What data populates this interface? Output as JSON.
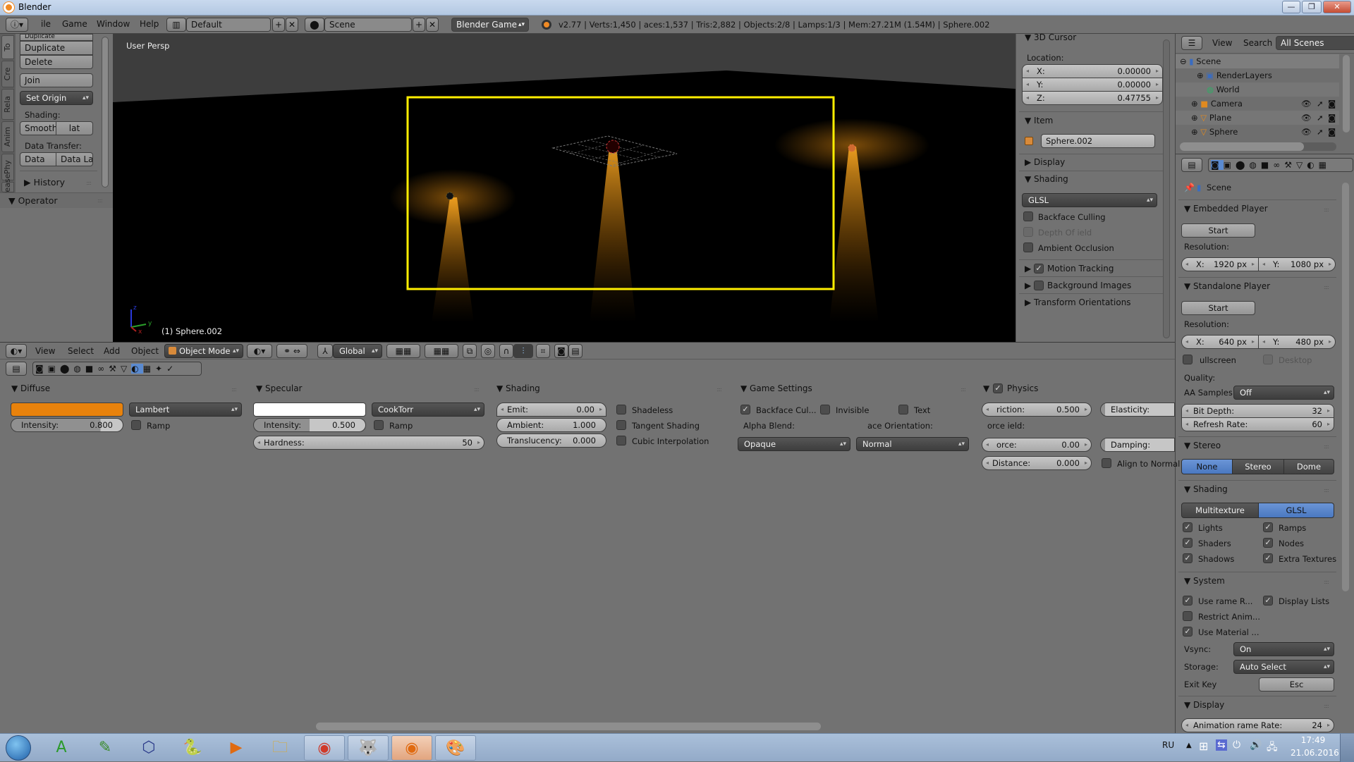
{
  "window": {
    "title": "Blender",
    "controls": {
      "minimize": "—",
      "restore": "❐",
      "close": "✕"
    }
  },
  "info_header": {
    "menus": [
      "ile",
      "Game",
      "Window",
      "Help"
    ],
    "layout": "Default",
    "scene": "Scene",
    "engine": "Blender Game",
    "stats": "v2.77 | Verts:1,450 |  aces:1,537 | Tris:2,882 | Objects:2/8 | Lamps:1/3 | Mem:27.21M (1.54M) | Sphere.002"
  },
  "tool_shelf": {
    "tabs": [
      "To",
      "Cre",
      "Rela",
      "Anim",
      "Phy",
      "Grease"
    ],
    "buttons": {
      "duplicate": "Duplicate",
      "duplicate_linked": "Duplicate Linked",
      "delete": "Delete",
      "join": "Join",
      "set_origin": "Set Origin"
    },
    "shading_label": "Shading:",
    "smooth": "Smooth",
    "flat": "lat",
    "data_transfer_label": "Data Transfer:",
    "data": "Data",
    "data_lay": "Data Lay",
    "history": "History",
    "operator": "Operator"
  },
  "viewport": {
    "view_label": "User Persp",
    "object_label": "(1) Sphere.002",
    "axis": {
      "x": "x",
      "y": "y",
      "z": "z"
    },
    "camera_frame_color": "#ffee00",
    "light_color": "#e08a10"
  },
  "n_panel": {
    "cursor_title": "3D Cursor",
    "location_label": "Location:",
    "x_label": "X:",
    "x": "0.00000",
    "y_label": "Y:",
    "y": "0.00000",
    "z_label": "Z:",
    "z": "0.47755",
    "item_title": "Item",
    "item_name": "Sphere.002",
    "display_title": "Display",
    "shading_title": "Shading",
    "shading_mode": "GLSL",
    "backface_culling": "Backface Culling",
    "depth_of_field": "Depth Of  ield",
    "ambient_occlusion": "Ambient Occlusion",
    "motion_tracking": "Motion Tracking",
    "background_images": "Background Images",
    "transform_orientations": "Transform Orientations"
  },
  "outliner": {
    "view": "View",
    "search": "Search",
    "filter": "All Scenes",
    "items": [
      {
        "name": "Scene"
      },
      {
        "name": "RenderLayers"
      },
      {
        "name": "World"
      },
      {
        "name": "Camera"
      },
      {
        "name": "Plane"
      },
      {
        "name": "Sphere"
      }
    ]
  },
  "properties": {
    "context": "Scene",
    "embedded_player": {
      "title": "Embedded Player",
      "start": "Start",
      "resolution": "Resolution:",
      "x_label": "X:",
      "x": "1920 px",
      "y_label": "Y:",
      "y": "1080 px"
    },
    "standalone_player": {
      "title": "Standalone Player",
      "start": "Start",
      "resolution": "Resolution:",
      "x_label": "X:",
      "x": "640 px",
      "y_label": "Y:",
      "y": "480 px",
      "fullscreen": "ullscreen",
      "desktop": "Desktop",
      "quality": "Quality:",
      "aa_label": "AA Samples:",
      "aa": "Off",
      "bit_depth_label": "Bit Depth:",
      "bit_depth": "32",
      "refresh_label": "Refresh Rate:",
      "refresh": "60"
    },
    "stereo": {
      "title": "Stereo",
      "options": [
        "None",
        "Stereo",
        "Dome"
      ],
      "selected": "None"
    },
    "shading": {
      "title": "Shading",
      "options": [
        "Multitexture",
        "GLSL"
      ],
      "selected": "GLSL",
      "checks": [
        "Lights",
        "Ramps",
        "Shaders",
        "Nodes",
        "Shadows",
        "Extra Textures"
      ]
    },
    "system": {
      "title": "System",
      "use_frame_rate": "Use  rame R...",
      "display_lists": "Display Lists",
      "restrict_anim": "Restrict Anim...",
      "use_material": "Use Material ...",
      "vsync_label": "Vsync:",
      "vsync": "On",
      "storage_label": "Storage:",
      "storage": "Auto Select",
      "exit_key_label": "Exit Key",
      "exit_key": "Esc"
    },
    "display": {
      "title": "Display",
      "anim_rate_label": "Animation  rame Rate:",
      "anim_rate": "24"
    }
  },
  "view3d_header": {
    "menus": [
      "View",
      "Select",
      "Add",
      "Object"
    ],
    "mode": "Object Mode",
    "orientation": "Global"
  },
  "material": {
    "diffuse": {
      "title": "Diffuse",
      "color": "#e8820c",
      "shader": "Lambert",
      "intensity_label": "Intensity:",
      "intensity": "0.800",
      "ramp": "Ramp"
    },
    "specular": {
      "title": "Specular",
      "color": "#ffffff",
      "shader": "CookTorr",
      "intensity_label": "Intensity:",
      "intensity": "0.500",
      "ramp": "Ramp",
      "hardness_label": "Hardness:",
      "hardness": "50"
    },
    "shading": {
      "title": "Shading",
      "emit_label": "Emit:",
      "emit": "0.00",
      "ambient_label": "Ambient:",
      "ambient": "1.000",
      "translucency_label": "Translucency:",
      "translucency": "0.000",
      "shadeless": "Shadeless",
      "tangent": "Tangent Shading",
      "cubic": "Cubic Interpolation"
    },
    "game_settings": {
      "title": "Game Settings",
      "backface": "Backface Cul...",
      "invisible": "Invisible",
      "text": "Text",
      "alpha_blend_label": "Alpha Blend:",
      "alpha_blend": "Opaque",
      "face_orient_label": "ace Orientation:",
      "face_orient": "Normal"
    },
    "physics": {
      "title": "Physics",
      "friction_label": "riction:",
      "friction": "0.500",
      "elasticity_label": "Elasticity:",
      "force_field_label": "orce  ield:",
      "force_label": "orce:",
      "force": "0.00",
      "damping_label": "Damping:",
      "distance_label": "Distance:",
      "distance": "0.000",
      "align_normal": "Align to Normal"
    }
  },
  "taskbar": {
    "lang": "RU",
    "time": "17:49",
    "date": "21.06.2016"
  }
}
